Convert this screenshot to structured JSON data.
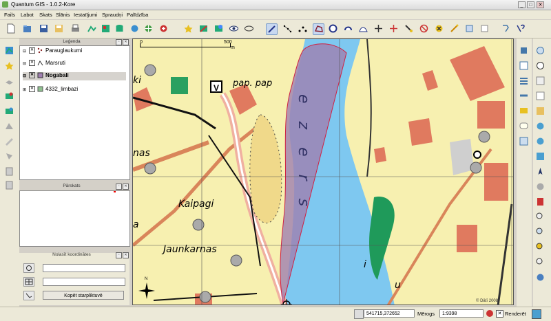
{
  "window": {
    "title": "Quantum GIS - 1.0.2-Kore",
    "minimize": "_",
    "maximize": "□",
    "close": "✕"
  },
  "menu": [
    "Fails",
    "Labot",
    "Skats",
    "Slānis",
    "Iestatījumi",
    "Spraudņi",
    "Palīdzība"
  ],
  "toolbar_icons": [
    "new-project-icon",
    "open-project-icon",
    "save-project-icon",
    "save-as-icon",
    "print-icon",
    "add-vector-icon",
    "add-raster-icon",
    "add-postgis-icon",
    "add-spatialite-icon",
    "add-wms-icon",
    "new-layer-icon",
    "remove-layer-icon",
    "overview-icon",
    "show-all-icon",
    "hide-all-icon",
    "capture-line-icon",
    "capture-point-icon",
    "capture-polygon-icon",
    "move-feature-icon",
    "node-tool-icon",
    "add-ring-icon",
    "add-part-icon",
    "delete-part-icon",
    "split-icon",
    "cut-icon",
    "delete-selected-icon",
    "copy-icon",
    "paste-icon",
    "plugin-icon",
    "whats-this-icon"
  ],
  "legend": {
    "title": "Leģenda",
    "layers": [
      {
        "name": "Parauglaukumi",
        "checked": true,
        "selected": false
      },
      {
        "name": "Marsruti",
        "checked": true,
        "selected": false
      },
      {
        "name": "Nogabali",
        "checked": true,
        "selected": true
      },
      {
        "name": "4332_limbazi",
        "checked": true,
        "selected": false
      }
    ]
  },
  "overview": {
    "title": "Pārskats"
  },
  "coords_panel": {
    "title": "Nolasīt koordinātes",
    "field1": "",
    "field2": "",
    "copy_button": "Kopēt starpliktuvē"
  },
  "map": {
    "scalebar_start": "0",
    "scalebar_end": "500",
    "scalebar_unit": "m",
    "labels": {
      "pap_pap": "pap. pap",
      "kaipagi": "Kaipagi",
      "jaunkarnas": "Jaunkarnas",
      "lake": "ezers",
      "stub_a": "ki",
      "stub_b": "nas",
      "stub_c": "a",
      "stub_d": "i",
      "stub_e": "u"
    },
    "north": "N",
    "copyright": "© Dātī 2008",
    "marker": "V"
  },
  "status": {
    "coordinates": "541715,372652",
    "scale_label": "Mērogs",
    "scale_value": "1:9398",
    "render_label": "Renderēt"
  },
  "colors": {
    "water": "#7ec8f0",
    "land": "#f7f0b0",
    "forest": "#1f9a5a",
    "building": "#e07a5f",
    "selection": "#9f7fb0"
  }
}
